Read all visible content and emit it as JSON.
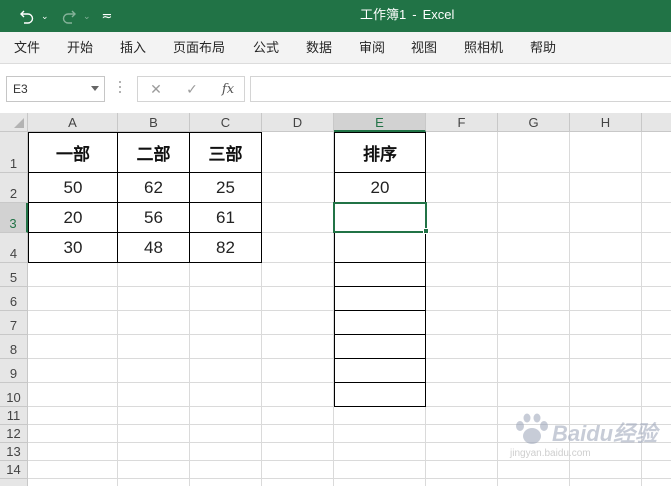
{
  "window": {
    "title_doc": "工作簿1",
    "title_sep": "-",
    "title_app": "Excel",
    "accent": "#217346"
  },
  "qat": {
    "undo_icon": "undo-icon",
    "redo_icon": "redo-icon",
    "customize_icon": "customize-qat-icon",
    "dropdown_glyph": "⌄",
    "customize_glyph": "≂"
  },
  "menu": [
    "文件",
    "开始",
    "插入",
    "页面布局",
    "公式",
    "数据",
    "审阅",
    "视图",
    "照相机",
    "帮助"
  ],
  "formula_bar": {
    "name_box": "E3",
    "cancel_glyph": "✕",
    "enter_glyph": "✓",
    "fx_label": "fx",
    "value": ""
  },
  "columns": [
    "A",
    "B",
    "C",
    "D",
    "E",
    "F",
    "G",
    "H"
  ],
  "selected_column": "E",
  "rows": [
    "1",
    "2",
    "3",
    "4",
    "5",
    "6",
    "7",
    "8",
    "9",
    "10",
    "11",
    "12",
    "13",
    "14"
  ],
  "selected_row": "3",
  "cells": {
    "A1": "一部",
    "B1": "二部",
    "C1": "三部",
    "A2": "50",
    "B2": "62",
    "C2": "25",
    "A3": "20",
    "B3": "56",
    "C3": "61",
    "A4": "30",
    "B4": "48",
    "C4": "82",
    "E1": "排序",
    "E2": "20"
  },
  "active_cell": "E3",
  "watermark": {
    "text": "Baidu经验",
    "url": "jingyan.baidu.com"
  }
}
